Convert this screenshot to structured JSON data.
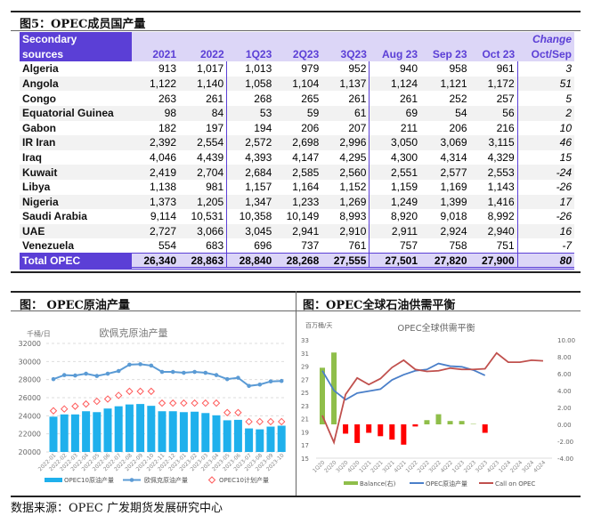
{
  "table": {
    "caption": "图5：OPEC成员国产量",
    "header_label": [
      "Secondary",
      "sources"
    ],
    "columns": [
      "2021",
      "2022",
      "1Q23",
      "2Q23",
      "3Q23",
      "Aug 23",
      "Sep 23",
      "Oct 23"
    ],
    "change_header": [
      "Change",
      "Oct/Sep"
    ],
    "rows": [
      {
        "name": "Algeria",
        "values": [
          "913",
          "1,017",
          "1,013",
          "979",
          "952",
          "940",
          "958",
          "961"
        ],
        "change": "3"
      },
      {
        "name": "Angola",
        "values": [
          "1,122",
          "1,140",
          "1,058",
          "1,104",
          "1,137",
          "1,124",
          "1,121",
          "1,172"
        ],
        "change": "51"
      },
      {
        "name": "Congo",
        "values": [
          "263",
          "261",
          "268",
          "265",
          "261",
          "261",
          "252",
          "257"
        ],
        "change": "5"
      },
      {
        "name": "Equatorial Guinea",
        "values": [
          "98",
          "84",
          "53",
          "59",
          "61",
          "69",
          "54",
          "56"
        ],
        "change": "2"
      },
      {
        "name": "Gabon",
        "values": [
          "182",
          "197",
          "194",
          "206",
          "207",
          "211",
          "206",
          "216"
        ],
        "change": "10"
      },
      {
        "name": "IR Iran",
        "values": [
          "2,392",
          "2,554",
          "2,572",
          "2,698",
          "2,996",
          "3,050",
          "3,069",
          "3,115"
        ],
        "change": "46"
      },
      {
        "name": "Iraq",
        "values": [
          "4,046",
          "4,439",
          "4,393",
          "4,147",
          "4,295",
          "4,300",
          "4,314",
          "4,329"
        ],
        "change": "15"
      },
      {
        "name": "Kuwait",
        "values": [
          "2,419",
          "2,704",
          "2,684",
          "2,585",
          "2,560",
          "2,551",
          "2,577",
          "2,553"
        ],
        "change": "-24"
      },
      {
        "name": "Libya",
        "values": [
          "1,138",
          "981",
          "1,157",
          "1,164",
          "1,152",
          "1,159",
          "1,169",
          "1,143"
        ],
        "change": "-26"
      },
      {
        "name": "Nigeria",
        "values": [
          "1,373",
          "1,205",
          "1,347",
          "1,233",
          "1,269",
          "1,249",
          "1,399",
          "1,416"
        ],
        "change": "17"
      },
      {
        "name": "Saudi Arabia",
        "values": [
          "9,114",
          "10,531",
          "10,358",
          "10,149",
          "8,993",
          "8,920",
          "9,018",
          "8,992"
        ],
        "change": "-26"
      },
      {
        "name": "UAE",
        "values": [
          "2,727",
          "3,066",
          "3,045",
          "2,941",
          "2,910",
          "2,911",
          "2,924",
          "2,940"
        ],
        "change": "16"
      },
      {
        "name": "Venezuela",
        "values": [
          "554",
          "683",
          "696",
          "737",
          "761",
          "757",
          "758",
          "751"
        ],
        "change": "-7"
      }
    ],
    "total": {
      "name": "Total  OPEC",
      "values": [
        "26,340",
        "28,863",
        "28,840",
        "28,268",
        "27,555",
        "27,501",
        "27,820",
        "27,900"
      ],
      "change": "80"
    }
  },
  "left_panel": {
    "caption": "图：  OPEC原油产量"
  },
  "right_panel": {
    "caption": "图：OPEC全球石油供需平衡"
  },
  "source": "数据来源：OPEC  广发期货发展研究中心",
  "chart_data": [
    {
      "type": "bar",
      "title": "欧佩克原油产量",
      "ylabel": "千桶/日",
      "ylim": [
        20000,
        32000
      ],
      "yticks": [
        "20000",
        "22000",
        "24000",
        "26000",
        "28000",
        "30000",
        "32000"
      ],
      "grid": true,
      "legend": "bottom",
      "categories": [
        "2022-01",
        "2022-02",
        "2022-03",
        "2022-04",
        "2022-05",
        "2022-06",
        "2022-07",
        "2022-08",
        "2022-09",
        "2022-10",
        "2022-11",
        "2022-12",
        "2023-01",
        "2023-02",
        "2023-03",
        "2023-04",
        "2023-05",
        "2023-06",
        "2023-07",
        "2023-08",
        "2023-09",
        "2023-10"
      ],
      "series": [
        {
          "name": "OPEC10原油产量",
          "kind": "bar",
          "color": "#1fb0ec",
          "values": [
            23900,
            24150,
            24150,
            24500,
            24400,
            24800,
            25050,
            25250,
            25300,
            25100,
            24500,
            24500,
            24400,
            24450,
            24300,
            24050,
            23500,
            23550,
            22600,
            22500,
            22800,
            22900
          ]
        },
        {
          "name": "欧佩克原油产量",
          "kind": "line",
          "color": "#5b9bd5",
          "values": [
            28050,
            28500,
            28450,
            28650,
            28400,
            28650,
            28950,
            29650,
            29700,
            29550,
            28850,
            28850,
            28750,
            28850,
            28750,
            28500,
            28050,
            28200,
            27300,
            27450,
            27800,
            27850
          ]
        },
        {
          "name": "OPEC10计划产量",
          "kind": "scatter",
          "color": "#ff5a5a",
          "values": [
            24550,
            24750,
            25050,
            25300,
            25600,
            25850,
            26250,
            26700,
            26700,
            26700,
            25400,
            25400,
            25400,
            25400,
            25400,
            25400,
            24350,
            24350,
            23350,
            23350,
            23350,
            23350
          ]
        }
      ]
    },
    {
      "type": "line",
      "title": "OPEC全球供需平衡",
      "ylabel": "百万桶/天",
      "ylim": [
        15,
        33
      ],
      "yticks": [
        "15",
        "17",
        "19",
        "21",
        "23",
        "25",
        "27",
        "29",
        "31",
        "33"
      ],
      "y2lim": [
        -4,
        10
      ],
      "y2ticks": [
        "-4.00",
        "-2.00",
        "0.00",
        "2.00",
        "4.00",
        "6.00",
        "8.00",
        "10.00"
      ],
      "legend": "bottom",
      "categories": [
        "1Q20",
        "2Q20",
        "3Q20",
        "4Q20",
        "1Q21",
        "2Q21",
        "3Q21",
        "4Q21",
        "1Q22",
        "2Q22",
        "3Q22",
        "4Q22",
        "1Q23",
        "2Q23",
        "3Q23",
        "4Q23",
        "1Q24",
        "2Q24",
        "3Q24",
        "4Q24"
      ],
      "series": [
        {
          "name": "Balance(右)",
          "kind": "bar",
          "axis": "right",
          "color_pos": "#8fbe4a",
          "color_neg": "#ff0000",
          "values": [
            6.7,
            8.5,
            -1.1,
            -2.2,
            -1.0,
            -1.4,
            -1.8,
            -2.4,
            -0.25,
            0.5,
            1.2,
            0.4,
            0.4,
            0.05,
            -1.0,
            null,
            null,
            null,
            null,
            null
          ]
        },
        {
          "name": "OPEC原油产量",
          "kind": "line",
          "axis": "left",
          "color": "#4a7fc9",
          "values": [
            28.3,
            25.3,
            23.9,
            24.9,
            25.2,
            25.5,
            26.9,
            27.7,
            28.3,
            28.5,
            29.4,
            29.0,
            28.9,
            28.4,
            27.6,
            null,
            null,
            null,
            null,
            null
          ]
        },
        {
          "name": "Call on OPEC",
          "kind": "line",
          "axis": "left",
          "color": "#c0504d",
          "values": [
            21.5,
            17.4,
            24.7,
            27.2,
            26.2,
            27.1,
            28.8,
            29.9,
            28.5,
            28.2,
            28.3,
            28.7,
            28.5,
            28.5,
            28.6,
            31.0,
            29.6,
            29.6,
            29.9,
            29.8
          ]
        }
      ]
    }
  ]
}
